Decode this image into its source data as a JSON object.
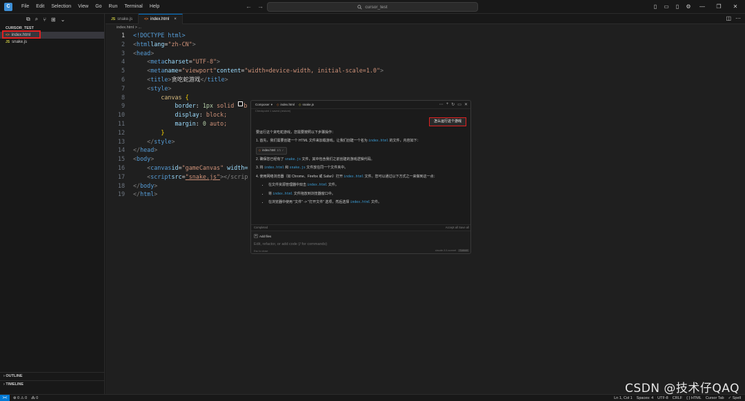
{
  "app": {
    "logo_text": "C",
    "menu": [
      "File",
      "Edit",
      "Selection",
      "View",
      "Go",
      "Run",
      "Terminal",
      "Help"
    ],
    "search_text": "cursor_test",
    "nav_back": "←",
    "nav_forward": "→"
  },
  "explorer": {
    "folder": "CURSOR_TEST",
    "files": [
      {
        "icon": "<>",
        "name": "index.html"
      },
      {
        "icon": "JS",
        "name": "snake.js"
      }
    ],
    "outline": "OUTLINE",
    "timeline": "TIMELINE"
  },
  "editor": {
    "tabs": [
      {
        "icon": "JS",
        "name": "snake.js"
      },
      {
        "icon": "<>",
        "name": "index.html",
        "close": "×"
      }
    ],
    "breadcrumb": "index.html > ...",
    "line_numbers": [
      "1",
      "2",
      "3",
      "4",
      "5",
      "6",
      "7",
      "8",
      "9",
      "10",
      "11",
      "12",
      "13",
      "14",
      "15",
      "16",
      "17",
      "18",
      "19"
    ],
    "code": {
      "l1_doctype": "<!DOCTYPE html>",
      "l2_lang_val": "\"zh-CN\"",
      "l4_charset": "\"UTF-8\"",
      "l5_name": "\"viewport\"",
      "l5_content": "\"width=device-width, initial-scale=1.0\"",
      "l6_title": "贪吃蛇游戏",
      "l8_selector": "canvas",
      "l9_border": "1px",
      "l9_solid": "solid",
      "l9_rest": "b",
      "l10_display": "block;",
      "l11_margin_num": "0",
      "l11_margin_rest": "auto;",
      "l15_id": "\"gameCanvas\"",
      "l15_trunc": " width=",
      "l16_src": "\"snake.js\"",
      "l16_trunc": "></scrip"
    }
  },
  "composer": {
    "tabs": [
      "Composer",
      "index.html",
      "snake.js"
    ],
    "sub": "Checkpoint 1 saved  (restore)",
    "user_message": "怎么运行这个游戏",
    "reply_intro": "要运行这个贪吃蛇游戏，您需要按照以下步骤操作：",
    "step1": "1. 首先，我们需要创建一个 HTML 文件来加载游戏。让我们创建一个名为",
    "step1_code": "index.html",
    "step1_end": "的文件，内容如下：",
    "chip_label": "index.html",
    "chip_status": "1/1 ✓",
    "step2_a": "2. 确保您已经有了",
    "step2_code": "snake.js",
    "step2_b": "文件，其中包含我们之前创建的游戏逻辑代码。",
    "step3_a": "3. 将",
    "step3_code1": "index.html",
    "step3_and": "和",
    "step3_code2": "snake.js",
    "step3_b": "文件放在同一个文件夹中。",
    "step4_a": "4. 使用网络浏览器（如 Chrome、Firefox 或 Safari）打开",
    "step4_code": "index.html",
    "step4_b": "文件。您可以通过以下方式之一来做到这一点：",
    "bullet1_a": "在文件资源管理器中双击",
    "bullet1_code": "index.html",
    "bullet1_b": "文件。",
    "bullet2_a": "将",
    "bullet2_code": "index.html",
    "bullet2_b": "文件拖放到浏览器窗口中。",
    "bullet3_a": "在浏览器中使用 \"文件\" -> \"打开文件\" 选项，然后选择",
    "bullet3_code": "index.html",
    "bullet3_b": "文件。",
    "footer_left": "Completed",
    "footer_right": "Accept all   Save all",
    "add_files": "Add files",
    "placeholder": "Edit, refactor, or add code (/ for commands)",
    "bottom_hint": "Esc to close",
    "model": "claude-3.5-sonnet",
    "submit": "Submit"
  },
  "statusbar": {
    "remote": "><",
    "errors": "⊗ 0  ⚠ 0",
    "ports": "⁂ 0",
    "position": "Ln 1, Col 1",
    "spaces": "Spaces: 4",
    "encoding": "UTF-8",
    "eol": "CRLF",
    "language": "{ } HTML",
    "cursor_tab": "Cursor Tab",
    "spell": "✓ Spell"
  },
  "watermark": "CSDN @技术仔QAQ",
  "colors": {
    "accent": "#0078d4",
    "highlight_red": "#e02020",
    "html_icon": "#e37933",
    "js_icon": "#cbcb41"
  }
}
